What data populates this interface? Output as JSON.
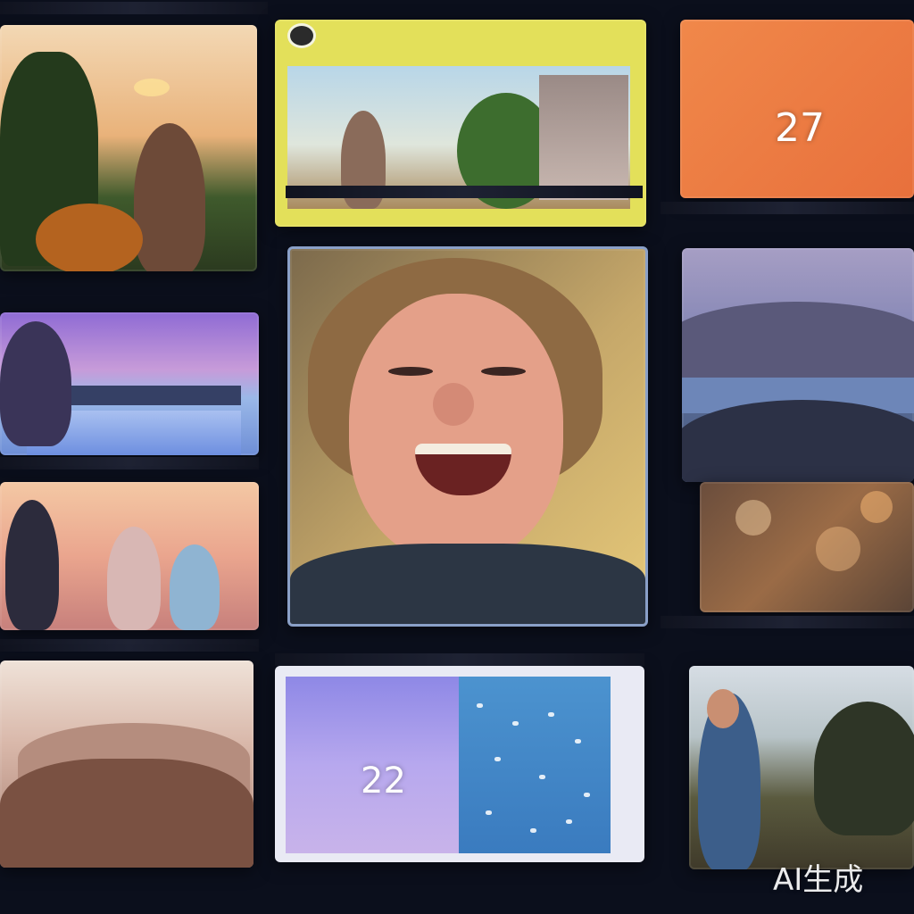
{
  "numbers": {
    "orange_panel": "27",
    "lavender_panel": "22"
  },
  "watermark": "AI生成"
}
